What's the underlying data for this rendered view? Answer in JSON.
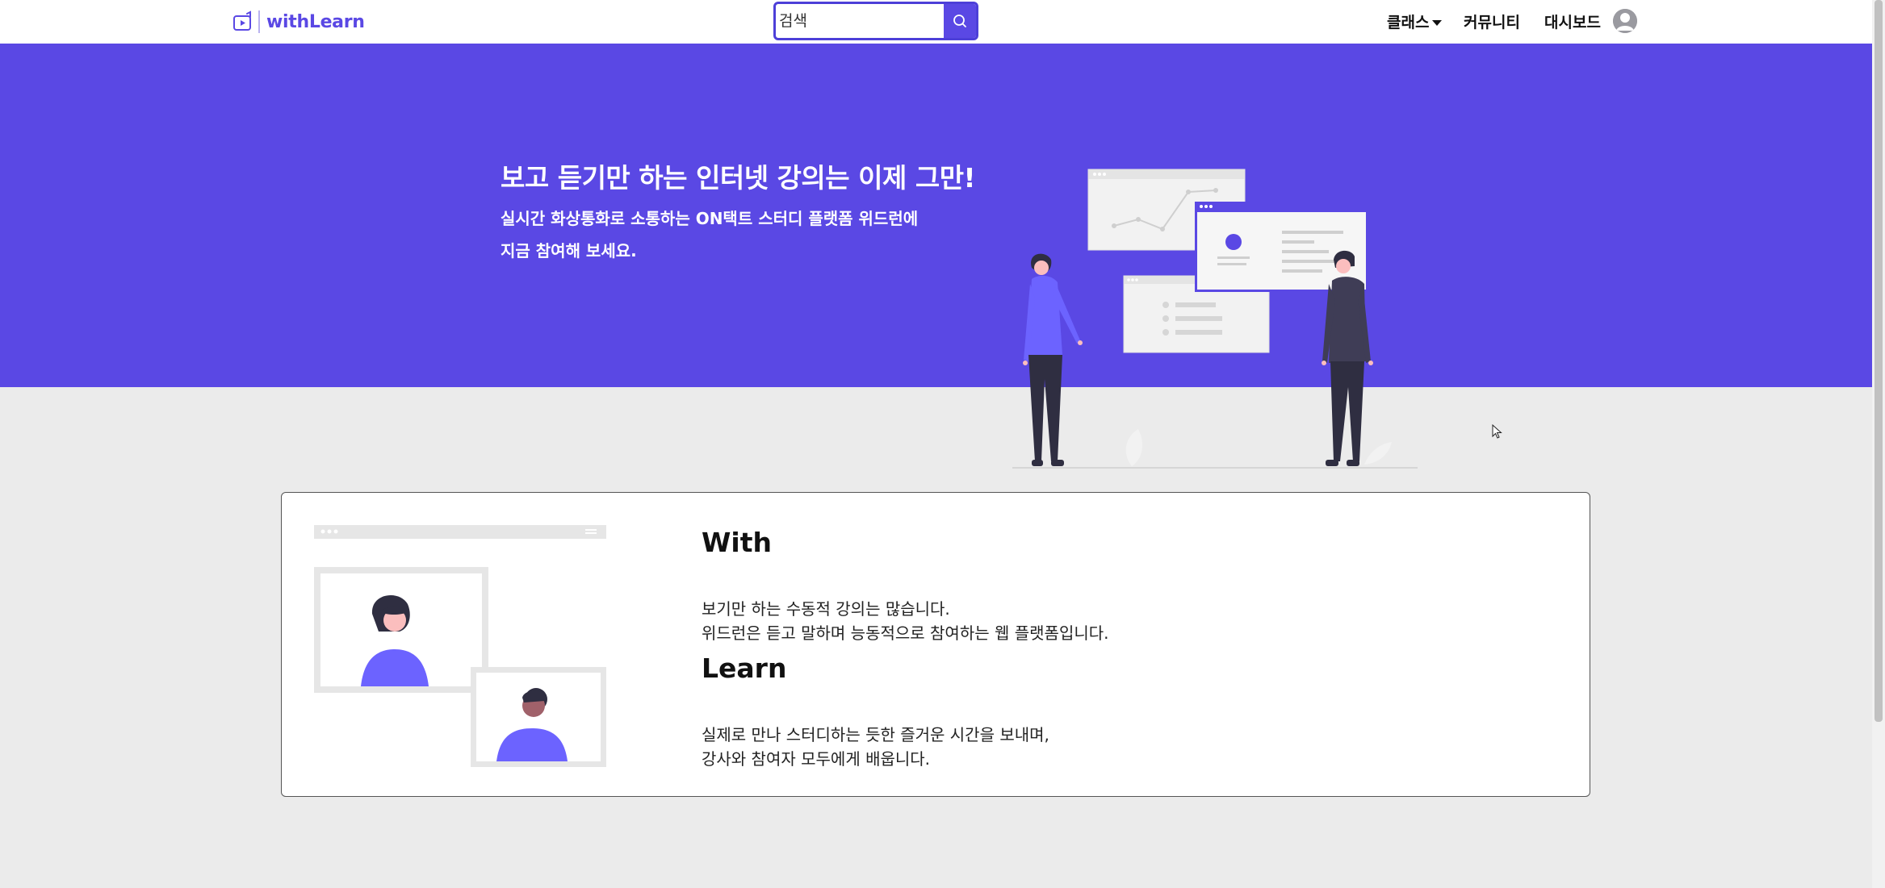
{
  "brand": {
    "name": "withLearn",
    "accent": "#5a48e4"
  },
  "search": {
    "placeholder": "검색",
    "button_icon": "search-icon"
  },
  "nav": {
    "class_label": "클래스",
    "community_label": "커뮤니티",
    "dashboard_label": "대시보드",
    "avatar_icon": "user-avatar-icon"
  },
  "hero": {
    "title": "보고 듣기만 하는 인터넷 강의는 이제 그만!",
    "subtitle_line1": "실시간 화상통화로 소통하는 ON택트 스터디 플랫폼 위드런에",
    "subtitle_line2": "지금 참여해 보세요."
  },
  "card": {
    "with": {
      "title": "With",
      "line1": "보기만 하는 수동적 강의는 많습니다.",
      "line2": "위드런은 듣고 말하며 능동적으로 참여하는 웹 플랫폼입니다."
    },
    "learn": {
      "title": "Learn",
      "line1": "실제로 만나 스터디하는 듯한 즐거운 시간을 보내며,",
      "line2": "강사와 참여자 모두에게 배웁니다."
    }
  }
}
